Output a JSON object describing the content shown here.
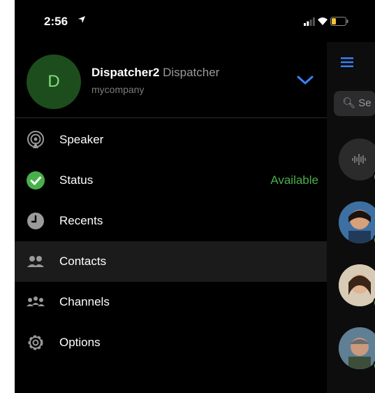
{
  "status_bar": {
    "time": "2:56"
  },
  "profile": {
    "initial": "D",
    "name": "Dispatcher2",
    "role": "Dispatcher",
    "company": "mycompany"
  },
  "menu": [
    {
      "label": "Speaker",
      "icon": "speaker-icon"
    },
    {
      "label": "Status",
      "value": "Available",
      "icon": "status-check-icon"
    },
    {
      "label": "Recents",
      "icon": "clock-icon"
    },
    {
      "label": "Contacts",
      "icon": "contacts-icon",
      "selected": true
    },
    {
      "label": "Channels",
      "icon": "channels-icon"
    },
    {
      "label": "Options",
      "icon": "gear-icon"
    }
  ],
  "right_pane": {
    "search_placeholder": "Se"
  },
  "colors": {
    "accent_blue": "#3a82f7",
    "online_green": "#48b04a",
    "avatar_bg": "#1d4d1d"
  }
}
